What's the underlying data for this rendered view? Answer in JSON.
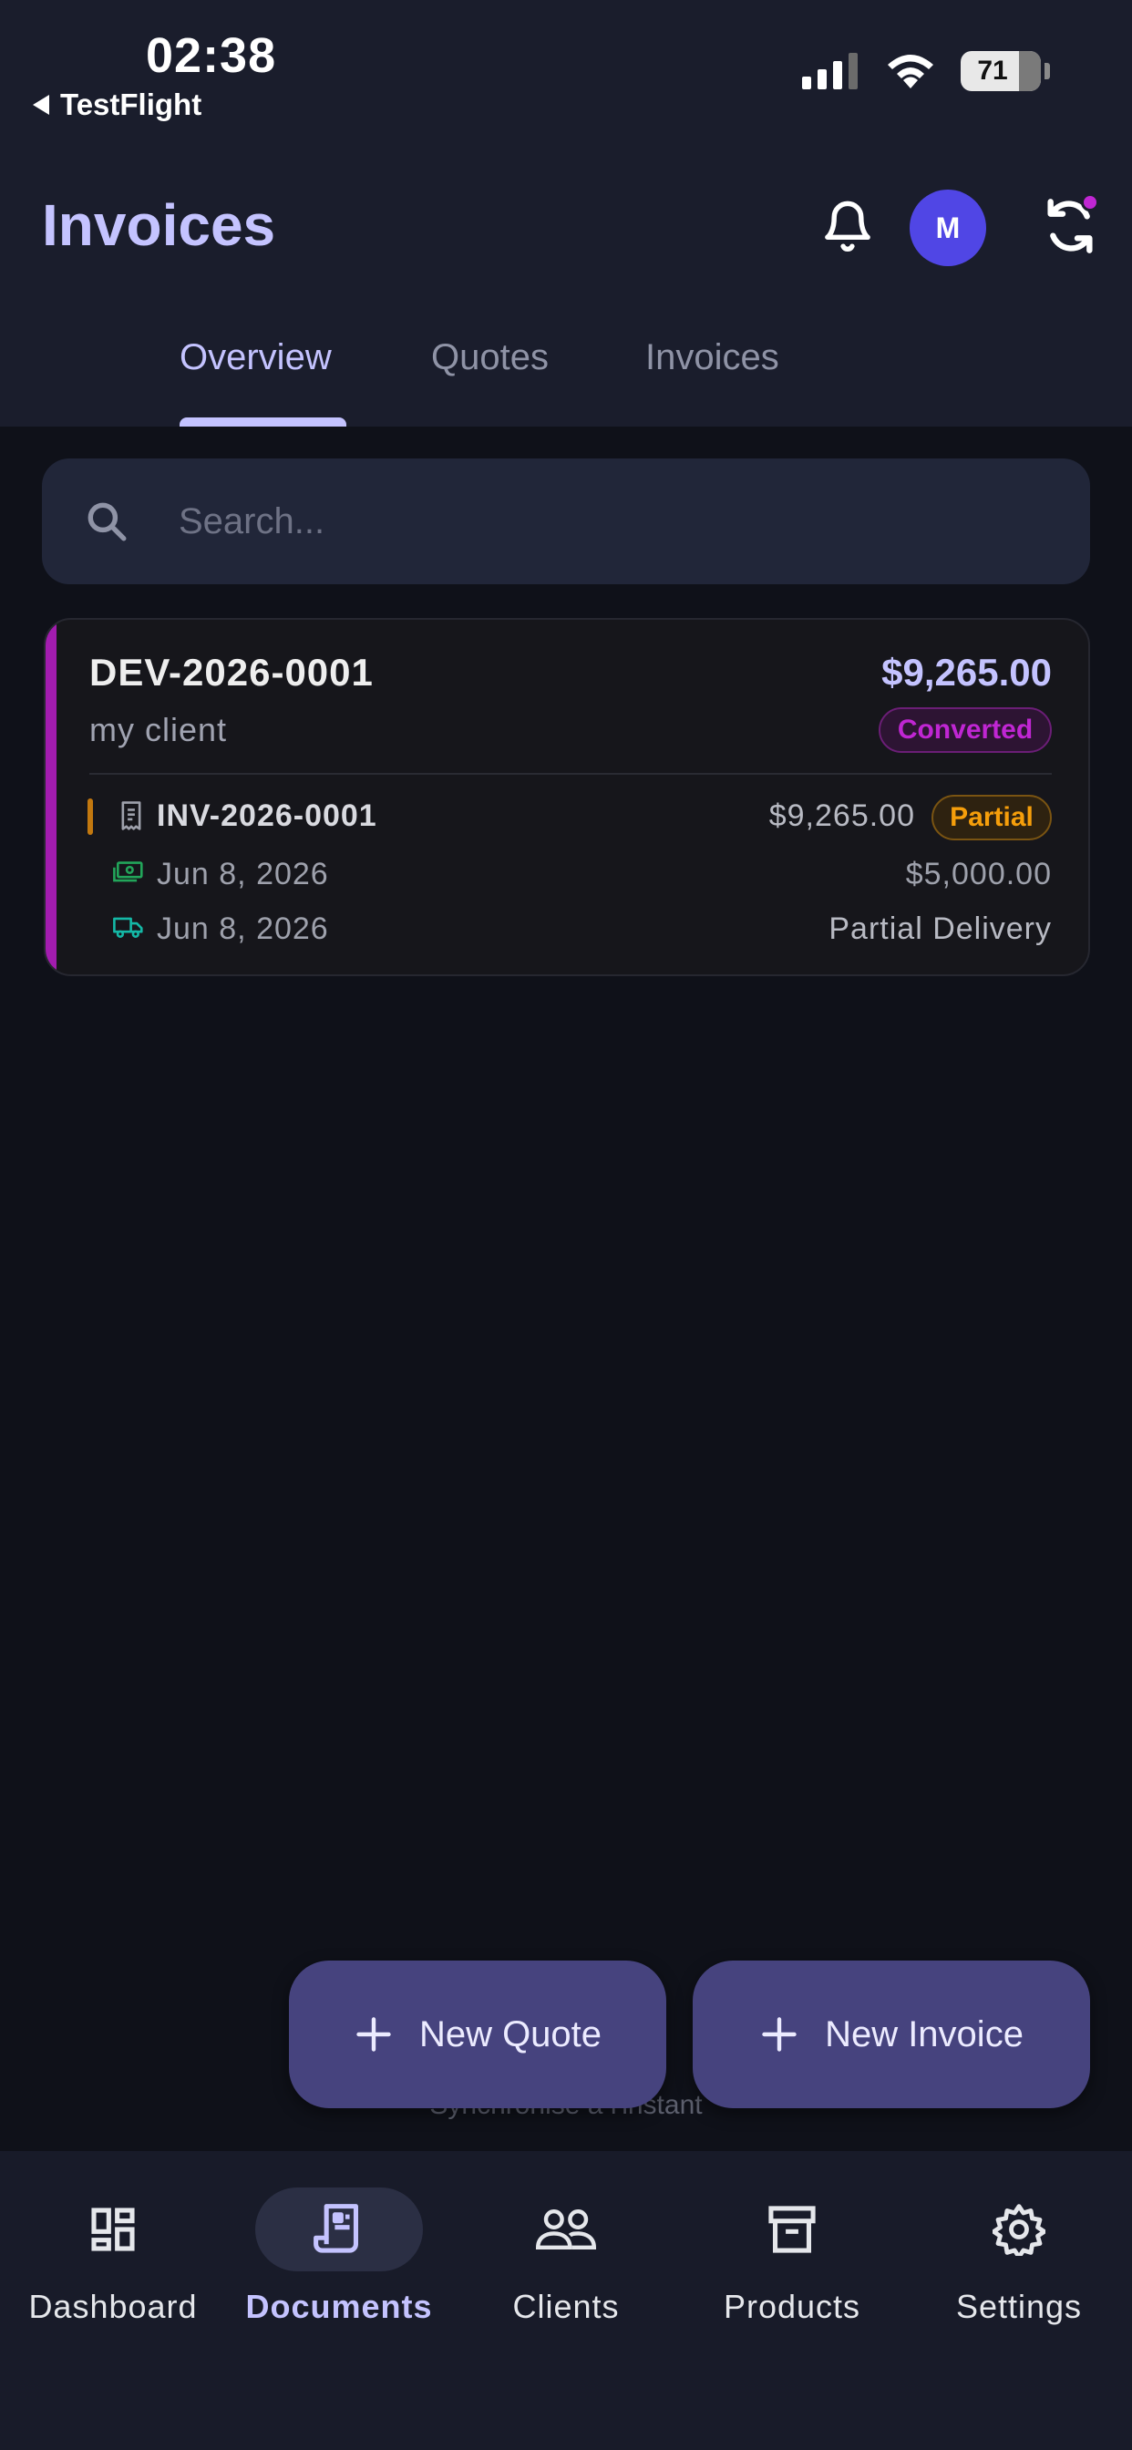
{
  "status_bar": {
    "time": "02:38",
    "back_label": "TestFlight",
    "battery": "71",
    "icons": [
      "signal-icon",
      "wifi-icon",
      "battery-icon"
    ]
  },
  "header": {
    "title": "Invoices",
    "avatar_initial": "M",
    "icons": [
      "bell-icon",
      "sync-icon"
    ]
  },
  "tabs": [
    {
      "label": "Overview",
      "active": true
    },
    {
      "label": "Quotes",
      "active": false
    },
    {
      "label": "Invoices",
      "active": false
    }
  ],
  "search": {
    "placeholder": "Search...",
    "value": ""
  },
  "documents": [
    {
      "number": "DEV-2026-0001",
      "amount": "$9,265.00",
      "client": "my client",
      "status": "Converted",
      "linked": {
        "number": "INV-2026-0001",
        "amount": "$9,265.00",
        "status": "Partial",
        "payment_date": "Jun 8, 2026",
        "paid_amount": "$5,000.00",
        "delivery_date": "Jun 8, 2026",
        "delivery_status": "Partial Delivery"
      }
    }
  ],
  "sync_label": "Synchronisé à l'instant",
  "actions": {
    "new_quote": "New Quote",
    "new_invoice": "New Invoice"
  },
  "nav": [
    {
      "label": "Dashboard",
      "icon": "dashboard-icon",
      "active": false
    },
    {
      "label": "Documents",
      "icon": "receipt-icon",
      "active": true
    },
    {
      "label": "Clients",
      "icon": "users-icon",
      "active": false
    },
    {
      "label": "Products",
      "icon": "archive-icon",
      "active": false
    },
    {
      "label": "Settings",
      "icon": "gear-icon",
      "active": false
    }
  ],
  "colors": {
    "accent": "#c4c3ff",
    "primary": "#5046e5",
    "converted": "#c026d3",
    "partial": "#f59e0b",
    "background": "#0f1119"
  }
}
